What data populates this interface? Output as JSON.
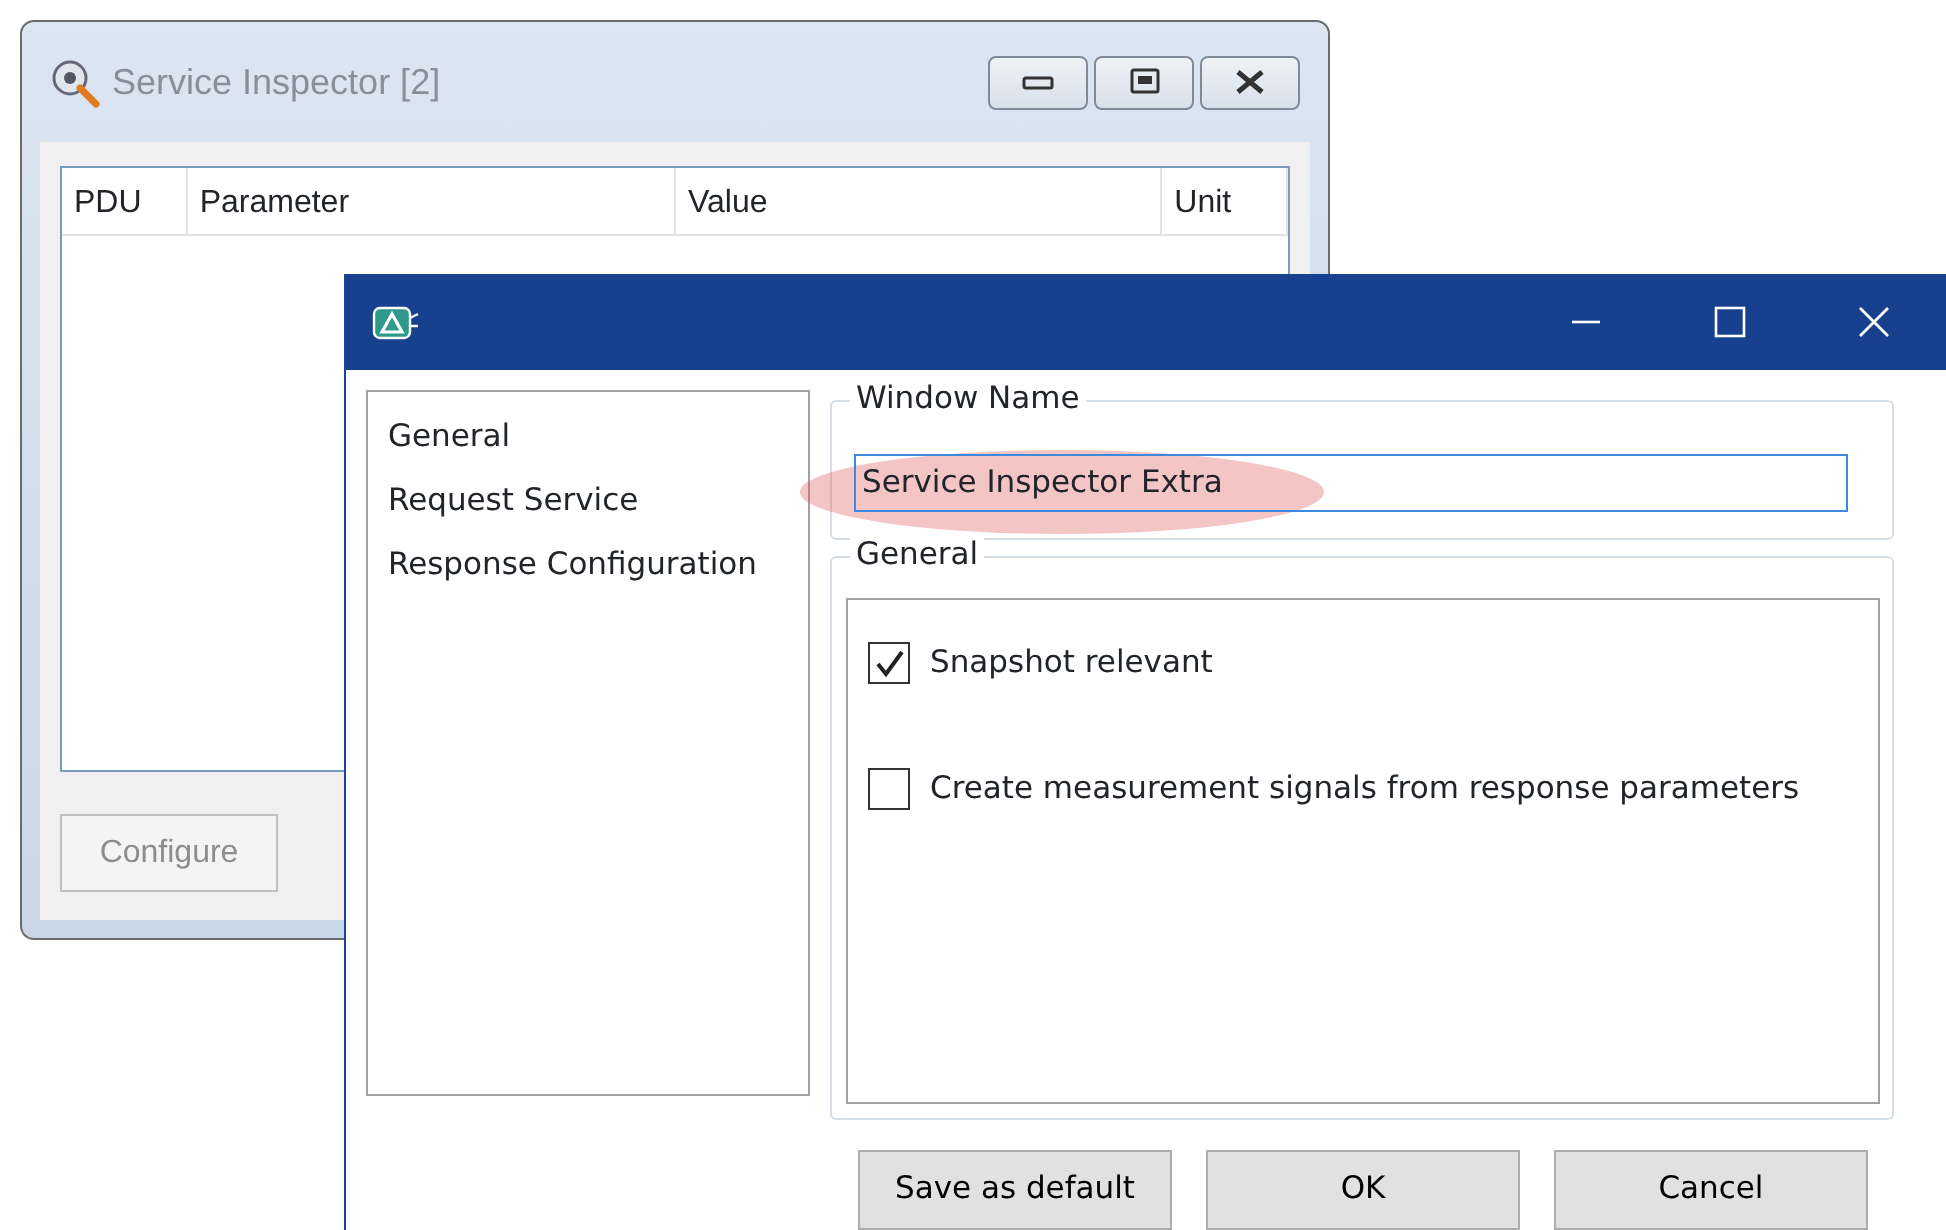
{
  "background_window": {
    "title": "Service Inspector [2]",
    "active": false,
    "table": {
      "columns": [
        "PDU",
        "Parameter",
        "Value",
        "Unit"
      ]
    },
    "buttons": [
      {
        "label": "Configure",
        "disabled": true
      }
    ]
  },
  "dialog": {
    "active": true,
    "sidebar": {
      "items": [
        {
          "label": "General",
          "selected": false
        },
        {
          "label": "Request Service",
          "selected": false
        },
        {
          "label": "Response Configuration",
          "selected": false
        }
      ]
    },
    "window_name": {
      "label": "Window Name",
      "value": "Service Inspector Extra",
      "highlighted": true
    },
    "general": {
      "label": "General",
      "options": [
        {
          "label": "Snapshot relevant",
          "checked": true
        },
        {
          "label": "Create measurement signals from response parameters",
          "checked": false
        }
      ]
    },
    "buttons": [
      "Save as default",
      "OK",
      "Cancel"
    ]
  }
}
